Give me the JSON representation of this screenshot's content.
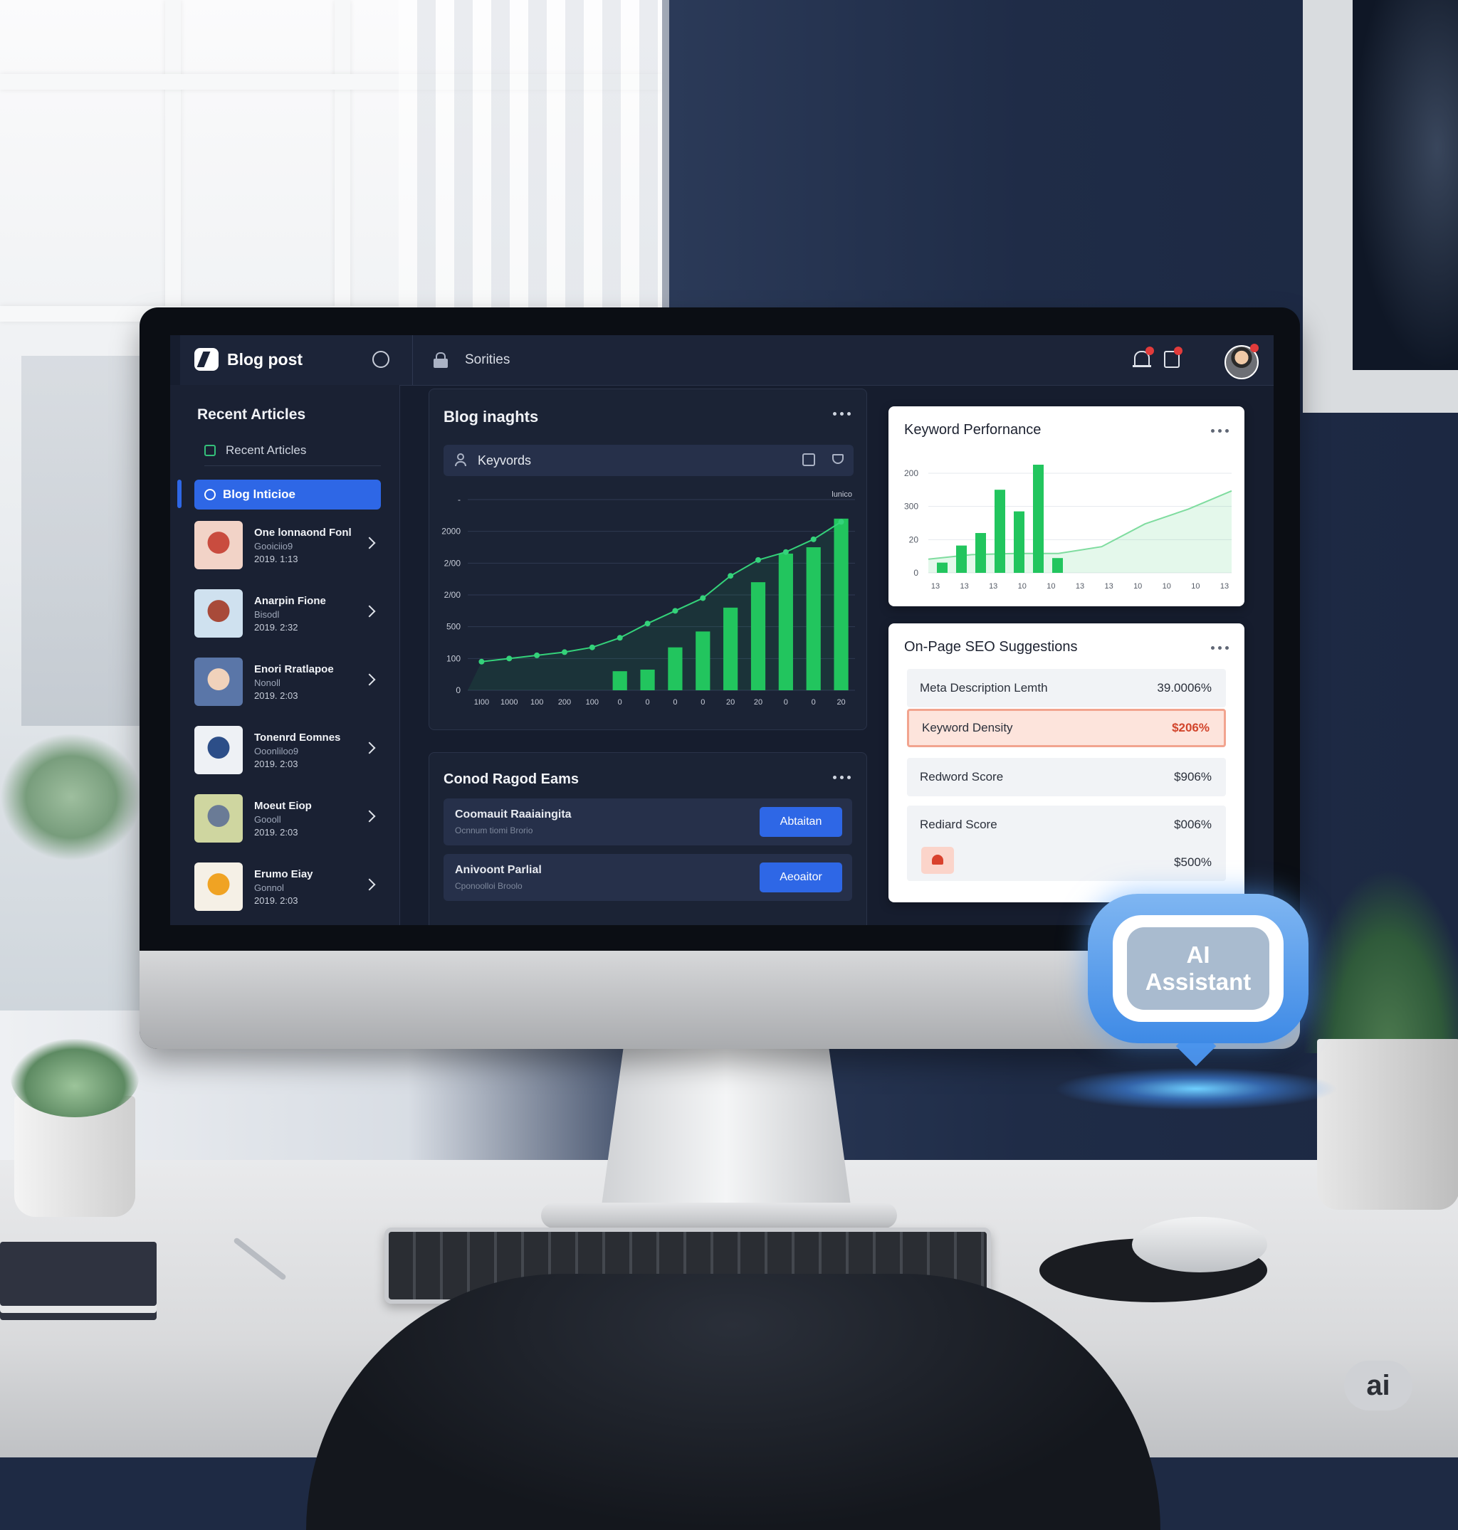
{
  "app": {
    "title": "Blog post",
    "top_label": "Sorities"
  },
  "sidebar": {
    "heading": "Recent Articles",
    "sub_item": "Recent Articles",
    "active_item": "Blog lnticioe",
    "articles": [
      {
        "title": "One lonnaond Fonl",
        "sub": "Gooiciio9",
        "date": "2019. 1:13",
        "colors": [
          "#f2d3c7",
          "#c94c3f"
        ]
      },
      {
        "title": "Anarpin Fione",
        "sub": "Bisodl",
        "date": "2019. 2:32",
        "colors": [
          "#cfe1ef",
          "#a84a39"
        ]
      },
      {
        "title": "Enori Rratlapoe",
        "sub": "Nonoll",
        "date": "2019. 2:03",
        "colors": [
          "#5a76a8",
          "#f0d2bb"
        ]
      },
      {
        "title": "Tonenrd Eomnes",
        "sub": "Ooonliloo9",
        "date": "2019. 2:03",
        "colors": [
          "#eef1f5",
          "#2c4e88"
        ]
      },
      {
        "title": "Moeut Eiop",
        "sub": "Goooll",
        "date": "2019. 2:03",
        "colors": [
          "#cfd6a0",
          "#6a7b96"
        ]
      },
      {
        "title": "Erumo Eiay",
        "sub": "Gonnol",
        "date": "2019. 2:03",
        "colors": [
          "#f5f0e6",
          "#f0a323"
        ]
      }
    ]
  },
  "insights": {
    "title": "Blog inaghts",
    "search_label": "Keyvords"
  },
  "tasks": {
    "title": "Conod Ragod Eams",
    "items": [
      {
        "title": "Coomauit Raaiaingita",
        "sub": "Ocnnum tiomi Brorio",
        "button": "Abtaitan"
      },
      {
        "title": "Anivoont Parlial",
        "sub": "Cponoolloi Broolo",
        "button": "Aeoaitor"
      }
    ]
  },
  "keyword_perf": {
    "title": "Keyword Perfornance"
  },
  "seo": {
    "title": "On-Page SEO Suggestions",
    "rows": [
      {
        "label": "Meta Description Lemth",
        "value": "39.0006%"
      },
      {
        "label": "Keyword Density",
        "value": "$206%"
      },
      {
        "label": "Redword Score",
        "value": "$906%"
      },
      {
        "label": "Rediard Score",
        "value": "$006%",
        "value2": "$500%"
      }
    ]
  },
  "assistant": {
    "line1": "AI",
    "line2": "Assistant",
    "badge": "ai"
  },
  "chart_data": [
    {
      "type": "bar",
      "title": "Blog inaghts",
      "yticks": [
        "0",
        "100",
        "500",
        "2/00",
        "2/00",
        "2000",
        "-"
      ],
      "xticks": [
        "1I00",
        "1000",
        "100",
        "200",
        "100",
        "0",
        "0",
        "0",
        "0",
        "20",
        "20",
        "0",
        "0",
        "20"
      ],
      "corner_label": "lunico",
      "bars": [
        0,
        0,
        0,
        0,
        0,
        12,
        13,
        27,
        37,
        52,
        68,
        86,
        90,
        108
      ],
      "line": [
        18,
        20,
        22,
        24,
        27,
        33,
        42,
        50,
        58,
        72,
        82,
        87,
        95,
        106
      ],
      "accent": "#22c55e"
    },
    {
      "type": "bar",
      "title": "Keyword Perfornance",
      "yticks": [
        "0",
        "20",
        "300",
        "200"
      ],
      "xticks": [
        "13",
        "13",
        "13",
        "10",
        "10",
        "13",
        "13",
        "10",
        "10",
        "10",
        "13"
      ],
      "bars": [
        9,
        24,
        35,
        73,
        54,
        95,
        13
      ],
      "area": [
        12,
        16,
        17,
        17,
        23,
        43,
        56,
        72
      ],
      "accent": "#22c55e"
    }
  ]
}
